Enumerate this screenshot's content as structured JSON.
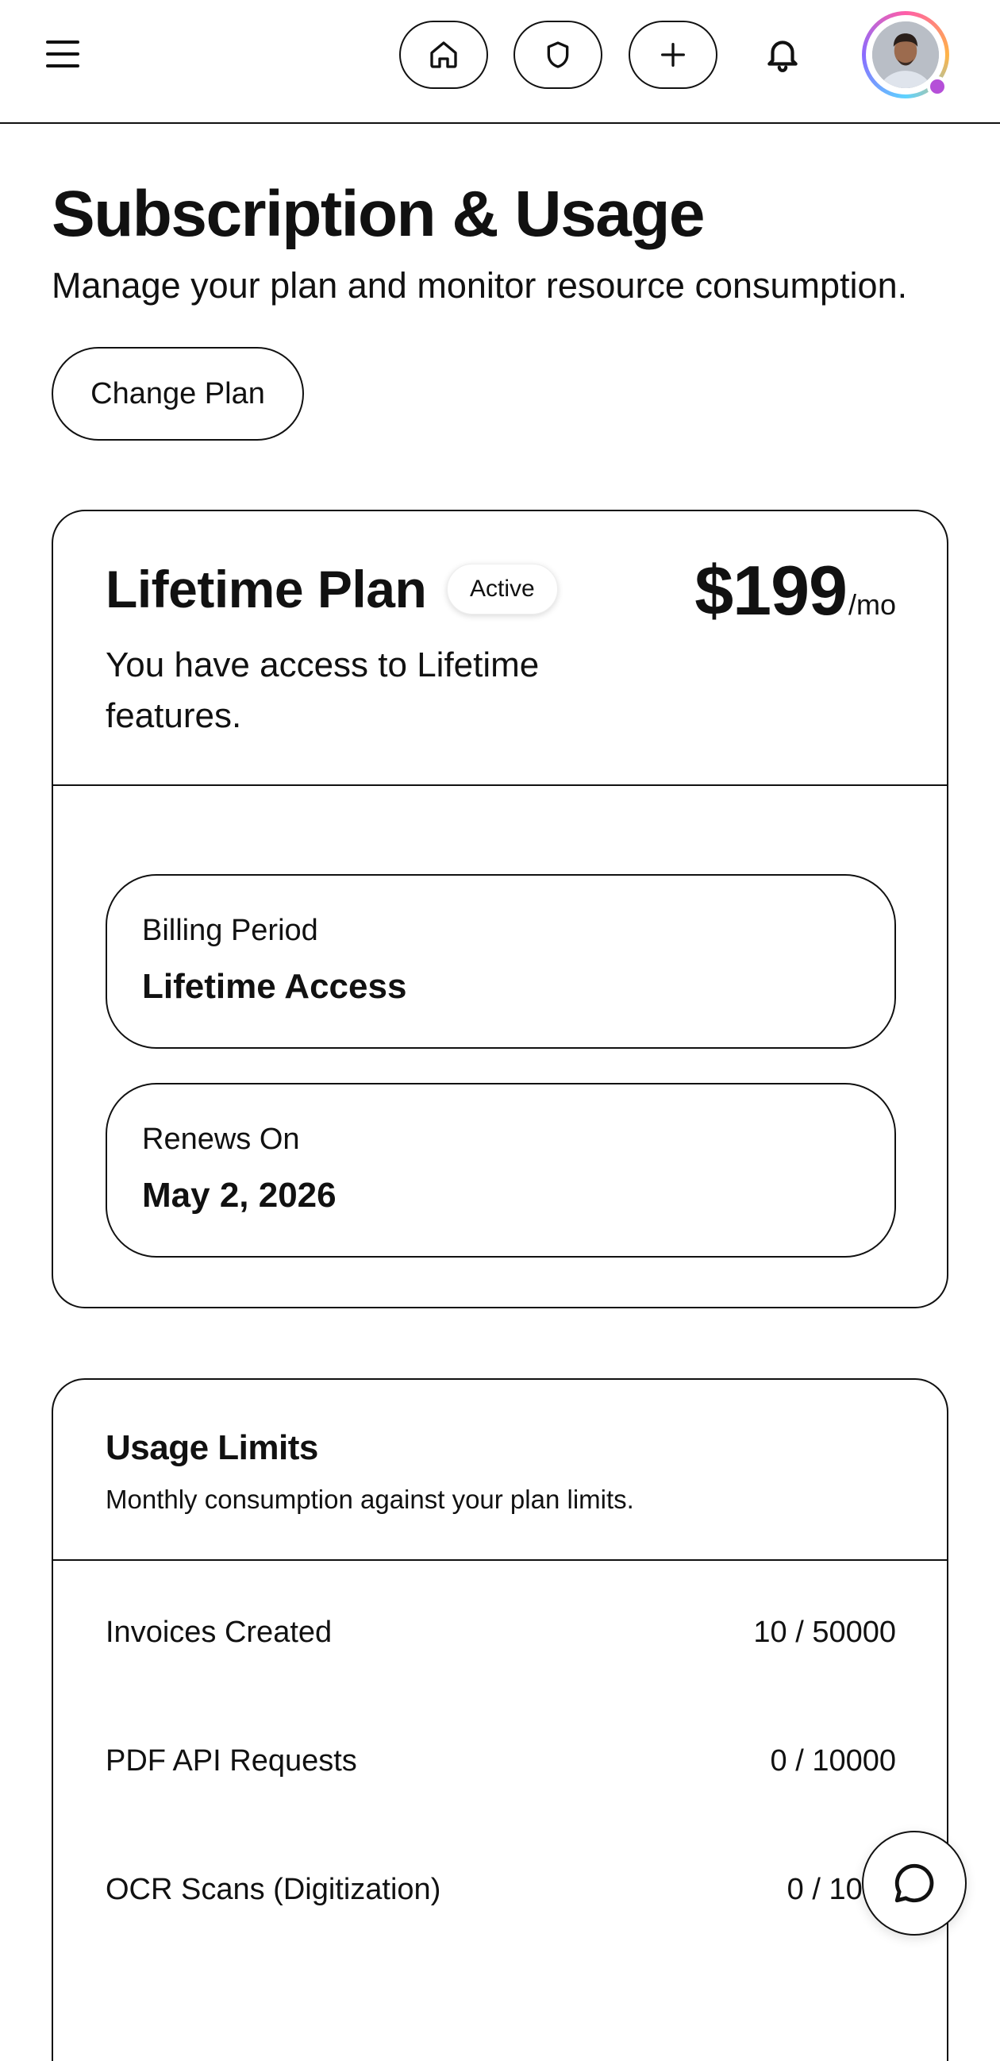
{
  "header": {
    "menu_icon": "hamburger-menu-icon",
    "nav": [
      {
        "icon": "home-icon"
      },
      {
        "icon": "shield-icon"
      },
      {
        "icon": "plus-icon"
      }
    ],
    "notification_icon": "bell-icon",
    "avatar_status_color": "#b54fd8"
  },
  "page": {
    "title": "Subscription & Usage",
    "subtitle": "Manage your plan and monitor resource consumption.",
    "change_plan_label": "Change Plan"
  },
  "plan": {
    "name": "Lifetime Plan",
    "status": "Active",
    "price": "$199",
    "price_unit": "/mo",
    "description": "You have access to Lifetime features.",
    "billing_period_label": "Billing Period",
    "billing_period_value": "Lifetime Access",
    "renews_label": "Renews On",
    "renews_value": "May 2, 2026"
  },
  "usage": {
    "title": "Usage Limits",
    "subtitle": "Monthly consumption against your plan limits.",
    "rows": [
      {
        "label": "Invoices Created",
        "value": "10 / 50000"
      },
      {
        "label": "PDF API Requests",
        "value": "0 / 10000"
      },
      {
        "label": "OCR Scans (Digitization)",
        "value": "0 / 1000"
      }
    ]
  },
  "chat": {
    "icon": "chat-bubble-icon"
  }
}
